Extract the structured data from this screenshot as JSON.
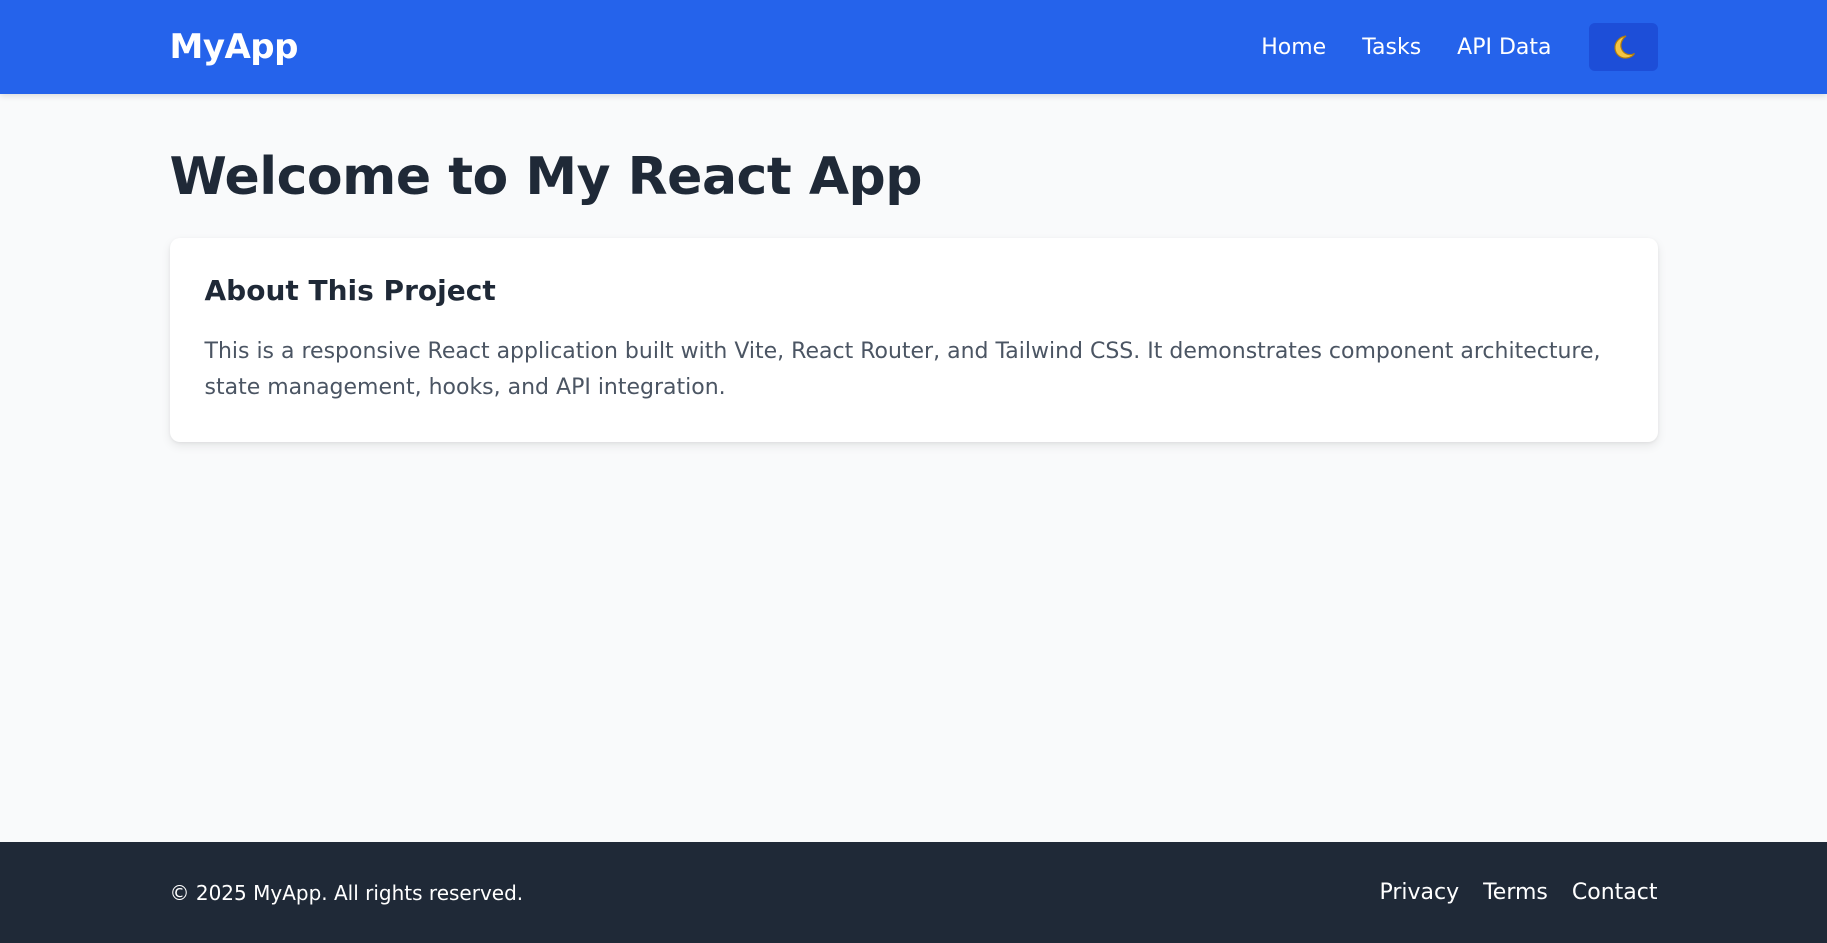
{
  "header": {
    "brand": "MyApp",
    "nav": [
      {
        "label": "Home"
      },
      {
        "label": "Tasks"
      },
      {
        "label": "API Data"
      }
    ],
    "theme_toggle_icon": "moon-icon"
  },
  "main": {
    "title": "Welcome to My React App",
    "card": {
      "title": "About This Project",
      "text": "This is a responsive React application built with Vite, React Router, and Tailwind CSS. It demonstrates component architecture, state management, hooks, and API integration."
    }
  },
  "footer": {
    "copyright": "© 2025 MyApp. All rights reserved.",
    "links": [
      {
        "label": "Privacy"
      },
      {
        "label": "Terms"
      },
      {
        "label": "Contact"
      }
    ]
  },
  "colors": {
    "header_bg": "#2563eb",
    "toggle_bg": "#1d4ed8",
    "footer_bg": "#1f2937",
    "page_bg": "#f9fafb",
    "heading": "#1f2937",
    "body_text": "#4b5563"
  }
}
